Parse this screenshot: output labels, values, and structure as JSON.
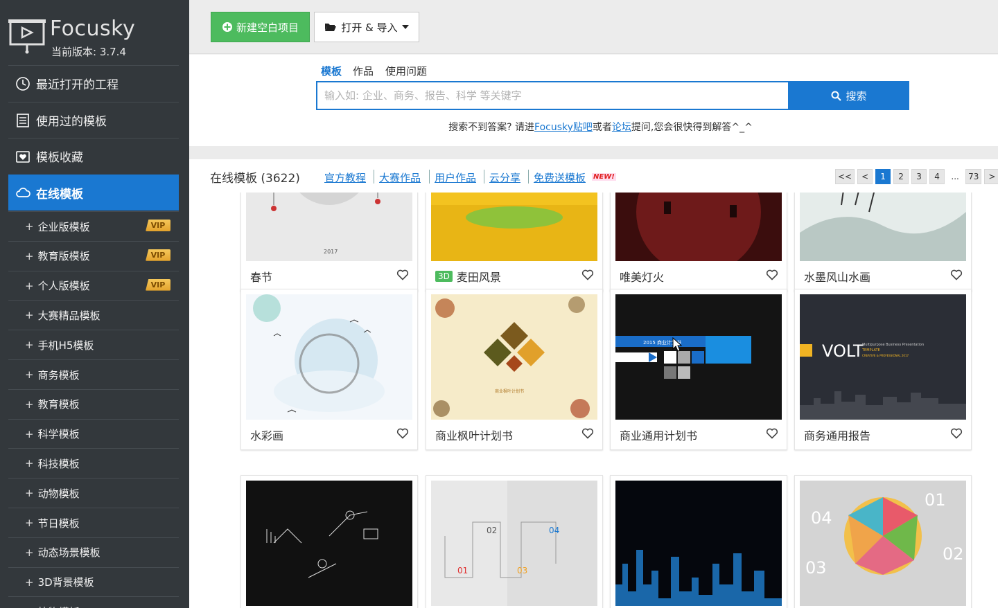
{
  "app": {
    "name": "Focusky",
    "version": "当前版本: 3.7.4"
  },
  "sidebar": {
    "main": [
      {
        "label": "最近打开的工程",
        "icon": "clock-icon"
      },
      {
        "label": "使用过的模板",
        "icon": "list-icon"
      },
      {
        "label": "模板收藏",
        "icon": "heart-box-icon"
      },
      {
        "label": "在线模板",
        "icon": "cloud-icon",
        "active": true
      }
    ],
    "sub": [
      {
        "label": "企业版模板",
        "vip": "VIP"
      },
      {
        "label": "教育版模板",
        "vip": "VIP"
      },
      {
        "label": "个人版模板",
        "vip": "VIP"
      },
      {
        "label": "大赛精品模板"
      },
      {
        "label": "手机H5模板"
      },
      {
        "label": "商务模板"
      },
      {
        "label": "教育模板"
      },
      {
        "label": "科学模板"
      },
      {
        "label": "科技模板"
      },
      {
        "label": "动物模板"
      },
      {
        "label": "节日模板"
      },
      {
        "label": "动态场景模板"
      },
      {
        "label": "3D背景模板"
      },
      {
        "label": "植物模板"
      }
    ],
    "plus": "+"
  },
  "toolbar": {
    "new_label": "新建空白项目",
    "open_label": "打开 & 导入"
  },
  "search": {
    "tabs": [
      "模板",
      "作品",
      "使用问题"
    ],
    "placeholder": "输入如: 企业、商务、报告、科学 等关键字",
    "button": "搜索",
    "help_prefix": "搜索不到答案? 请进",
    "help_link1": "Focusky贴吧",
    "help_mid": "或者",
    "help_link2": "论坛",
    "help_suffix": "提问,您会很快得到解答^_^"
  },
  "content": {
    "title": "在线模板 (3622)",
    "categories": [
      "官方教程",
      "大赛作品",
      "用户作品",
      "云分享",
      "免费送模板"
    ],
    "new_badge": "NEW!",
    "pager": [
      "<<",
      "<",
      "1",
      "2",
      "3",
      "4",
      "...",
      "73",
      ">",
      ">>"
    ],
    "current_page": "1"
  },
  "templates": [
    {
      "title": "春节",
      "badge": ""
    },
    {
      "title": "麦田风景",
      "badge": "3D"
    },
    {
      "title": "唯美灯火",
      "badge": ""
    },
    {
      "title": "水墨风山水画",
      "badge": ""
    },
    {
      "title": "水彩画",
      "badge": ""
    },
    {
      "title": "商业枫叶计划书",
      "badge": ""
    },
    {
      "title": "商业通用计划书",
      "badge": ""
    },
    {
      "title": "商务通用报告",
      "badge": ""
    },
    {
      "title": "",
      "badge": ""
    },
    {
      "title": "",
      "badge": ""
    },
    {
      "title": "",
      "badge": ""
    },
    {
      "title": "",
      "badge": ""
    }
  ],
  "thumb_text": {
    "spring_year": "2017",
    "volt": "VOLT",
    "volt_sub1": "Multipurpose Business Presentation",
    "volt_sub2": "TEMPLATE",
    "volt_sub3": "CREATIVE & PROFESSIONAL 2017",
    "blue_year": "2015 商业计划书",
    "numbers": [
      "01",
      "02",
      "03",
      "04"
    ]
  },
  "colors": {
    "accent": "#1a78d1",
    "green": "#4dbb5e",
    "sidebar": "#33383c",
    "vip": "#f2b441"
  }
}
